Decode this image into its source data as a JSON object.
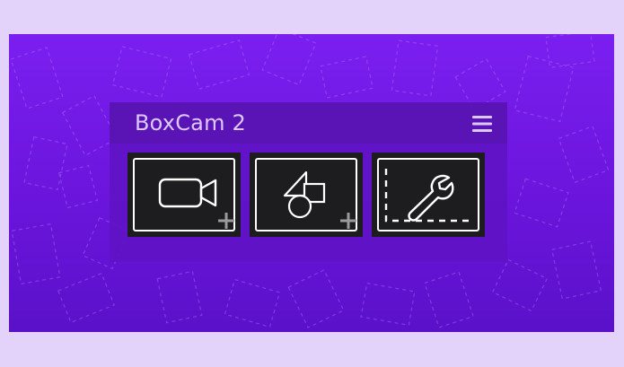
{
  "app": {
    "title": "BoxCam 2"
  },
  "header": {
    "menu_icon": "hamburger-menu-icon"
  },
  "tiles": [
    {
      "id": "add-camera",
      "icon": "video-camera-icon",
      "badge": "plus-icon"
    },
    {
      "id": "add-shape",
      "icon": "shapes-icon",
      "badge": "plus-icon"
    },
    {
      "id": "settings",
      "icon": "wrench-icon",
      "badge": "dashed-frame-icon"
    }
  ],
  "colors": {
    "page_background": "#e3d3fb",
    "stage_gradient_top": "#7a1ff0",
    "stage_gradient_bottom": "#5a11c9",
    "panel_background": "#6014c4",
    "header_background": "#5a13b5",
    "title_text": "#dcc8ff",
    "tile_background": "#1d1d1f",
    "icon_stroke": "#ffffff",
    "plus_badge": "#9a9a9a"
  }
}
